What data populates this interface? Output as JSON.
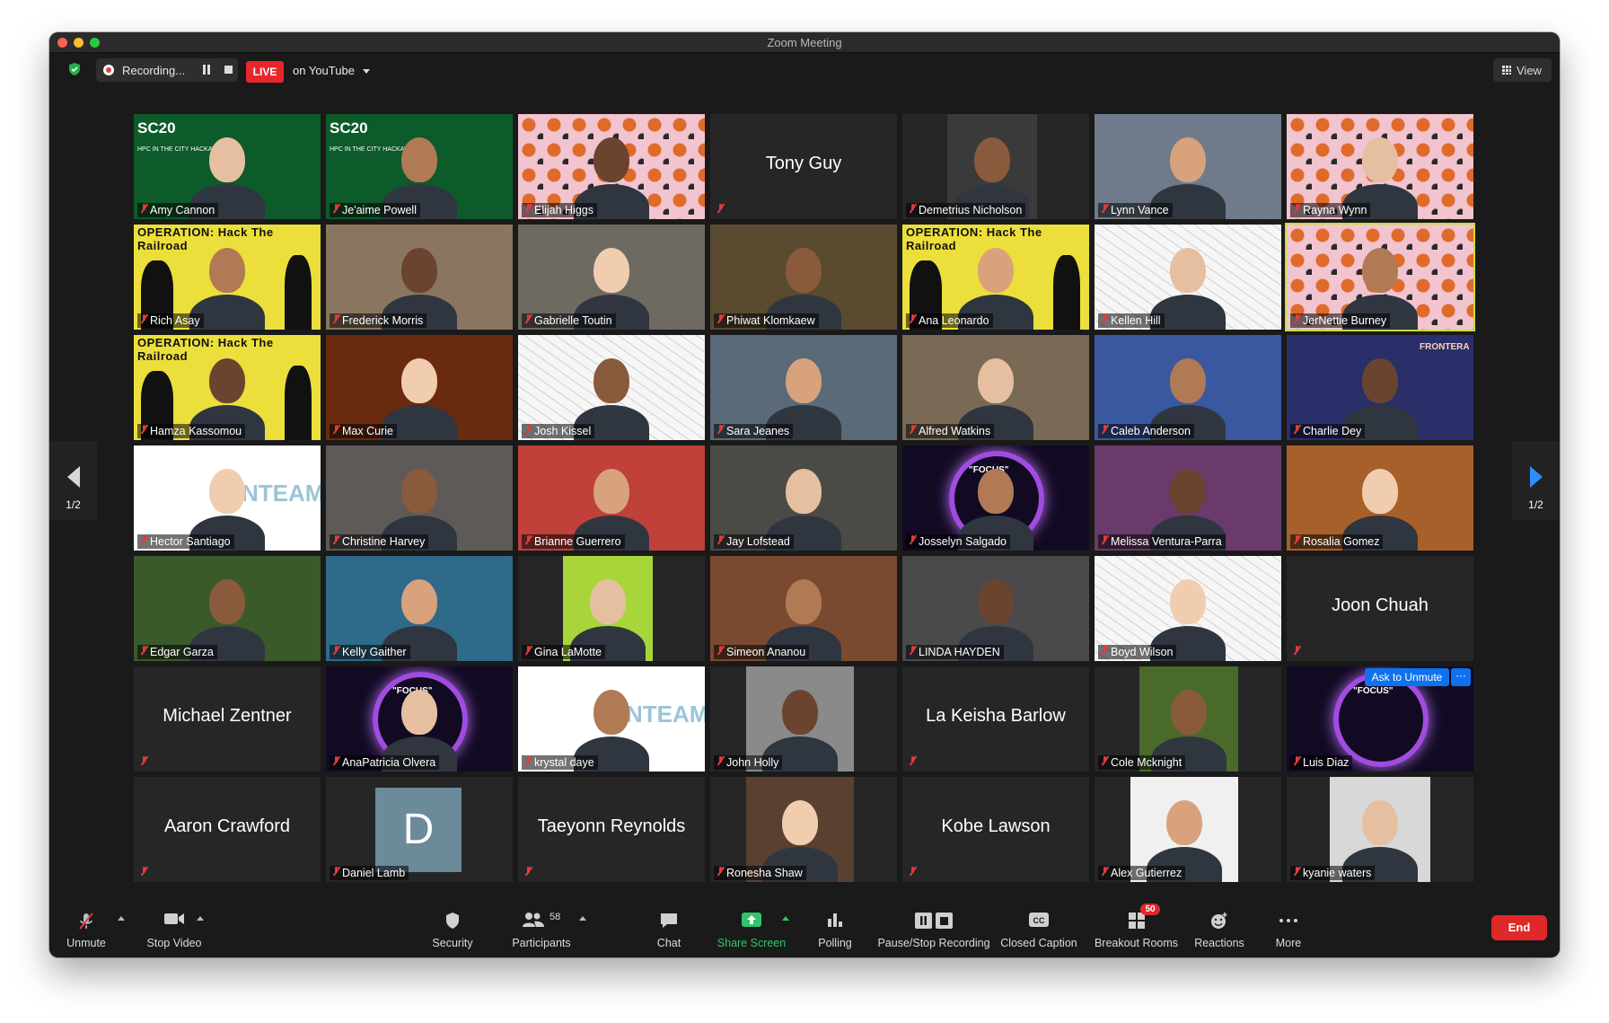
{
  "window": {
    "title": "Zoom Meeting"
  },
  "topbar": {
    "recording_label": "Recording...",
    "live_badge": "LIVE",
    "live_destination": "on YouTube",
    "view_label": "View"
  },
  "navigation": {
    "prev_page": "1/2",
    "next_page": "1/2"
  },
  "ask_to_unmute": {
    "label": "Ask to Unmute",
    "more": "···"
  },
  "participants": [
    {
      "name": "Amy Cannon"
    },
    {
      "name": "Je'aime Powell"
    },
    {
      "name": "Elijah Higgs"
    },
    {
      "name": "Tony Guy"
    },
    {
      "name": "Demetrius Nicholson"
    },
    {
      "name": "Lynn Vance"
    },
    {
      "name": "Rayna Wynn"
    },
    {
      "name": "Rich Asay"
    },
    {
      "name": "Frederick Morris"
    },
    {
      "name": "Gabrielle Toutin"
    },
    {
      "name": "Phiwat Klomkaew"
    },
    {
      "name": "Ana Leonardo"
    },
    {
      "name": "Kellen Hill"
    },
    {
      "name": "JerNettie Burney"
    },
    {
      "name": "Hamza Kassomou"
    },
    {
      "name": "Max Curie"
    },
    {
      "name": "Josh Kissel"
    },
    {
      "name": "Sara Jeanes"
    },
    {
      "name": "Alfred Watkins"
    },
    {
      "name": "Caleb Anderson"
    },
    {
      "name": "Charlie Dey"
    },
    {
      "name": "Hector Santiago"
    },
    {
      "name": "Christine Harvey"
    },
    {
      "name": "Brianne Guerrero"
    },
    {
      "name": "Jay Lofstead"
    },
    {
      "name": "Josselyn Salgado"
    },
    {
      "name": "Melissa Ventura-Parra"
    },
    {
      "name": "Rosalia Gomez"
    },
    {
      "name": "Edgar Garza"
    },
    {
      "name": "Kelly Gaither"
    },
    {
      "name": "Gina LaMotte"
    },
    {
      "name": "Simeon Ananou"
    },
    {
      "name": "LINDA HAYDEN"
    },
    {
      "name": "Boyd Wilson"
    },
    {
      "name": "Joon Chuah"
    },
    {
      "name": "Michael Zentner"
    },
    {
      "name": "AnaPatricia Olvera"
    },
    {
      "name": "krystal daye"
    },
    {
      "name": "John Holly"
    },
    {
      "name": "La Keisha Barlow"
    },
    {
      "name": "Cole Mcknight"
    },
    {
      "name": "Luis Diaz"
    },
    {
      "name": "Aaron Crawford"
    },
    {
      "name": "Daniel Lamb"
    },
    {
      "name": "Taeyonn Reynolds"
    },
    {
      "name": "Ronesha Shaw"
    },
    {
      "name": "Kobe Lawson"
    },
    {
      "name": "Alex Gutierrez"
    },
    {
      "name": "kyanie waters"
    }
  ],
  "tile_text": {
    "sc20": "SC20",
    "sc20_sub": "HPC IN THE CITY HACKATHON",
    "operation": "OPERATION: Hack The Railroad",
    "team": "NTEAM",
    "focus": "\"FOCUS\"",
    "frontera": "FRONTERA",
    "avatar_letter": "D"
  },
  "toolbar": {
    "unmute": "Unmute",
    "stop_video": "Stop Video",
    "security": "Security",
    "participants": "Participants",
    "participants_count": "58",
    "chat": "Chat",
    "share_screen": "Share Screen",
    "polling": "Polling",
    "pause_stop_recording": "Pause/Stop Recording",
    "closed_caption": "Closed Caption",
    "breakout_rooms": "Breakout Rooms",
    "breakout_badge": "50",
    "reactions": "Reactions",
    "more": "More",
    "end": "End"
  },
  "colors": {
    "accent_green": "#31c56a",
    "end_red": "#e02828",
    "live_red": "#e8262b",
    "active_speaker": "#c7df37",
    "ask_unmute_blue": "#0e72ed"
  }
}
